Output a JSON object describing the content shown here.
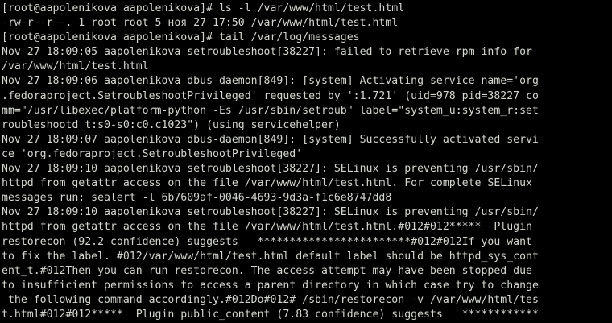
{
  "terminal": {
    "colors": {
      "background": "#000000",
      "foreground": "#d3d7cf"
    },
    "lines": [
      "[root@aapolenikova aapolenikova]# ls -l /var/www/html/test.html",
      "-rw-r--r--. 1 root root 5 ноя 27 17:50 /var/www/html/test.html",
      "[root@aapolenikova aapolenikova]# tail /var/log/messages",
      "Nov 27 18:09:05 aapolenikova setroubleshoot[38227]: failed to retrieve rpm info for",
      "/var/www/html/test.html",
      "Nov 27 18:09:06 aapolenikova dbus-daemon[849]: [system] Activating service name='org",
      ".fedoraproject.SetroubleshootPrivileged' requested by ':1.721' (uid=978 pid=38227 co",
      "mm=\"/usr/libexec/platform-python -Es /usr/sbin/setroub\" label=\"system_u:system_r:set",
      "roubleshootd_t:s0-s0:c0.c1023\") (using servicehelper)",
      "Nov 27 18:09:07 aapolenikova dbus-daemon[849]: [system] Successfully activated servi",
      "ce 'org.fedoraproject.SetroubleshootPrivileged'",
      "Nov 27 18:09:10 aapolenikova setroubleshoot[38227]: SELinux is preventing /usr/sbin/",
      "httpd from getattr access on the file /var/www/html/test.html. For complete SELinux",
      "messages run: sealert -l 6b7609af-0046-4693-9d3a-f1c6e8747dd8",
      "Nov 27 18:09:10 aapolenikova setroubleshoot[38227]: SELinux is preventing /usr/sbin/",
      "httpd from getattr access on the file /var/www/html/test.html.#012#012*****  Plugin",
      "restorecon (92.2 confidence) suggests   ************************#012#012If you want",
      "to fix the label. #012/var/www/html/test.html default label should be httpd_sys_cont",
      "ent_t.#012Then you can run restorecon. The access attempt may have been stopped due",
      "to insufficient permissions to access a parent directory in which case try to change",
      " the following command accordingly.#012Do#012# /sbin/restorecon -v /var/www/html/tes",
      "t.html#012#012*****  Plugin public_content (7.83 confidence) suggests   ************"
    ]
  }
}
